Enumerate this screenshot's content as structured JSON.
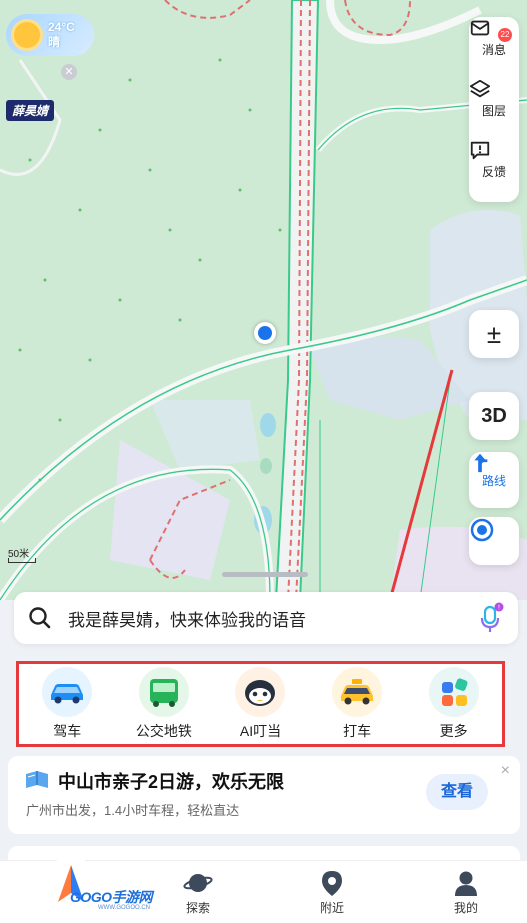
{
  "weather": {
    "temperature": "24°C",
    "condition": "晴",
    "icon": "sun-icon"
  },
  "user_tag": "薛昊婧",
  "side_panel": {
    "items": [
      {
        "label": "消息",
        "icon": "mail-icon",
        "badge": "22"
      },
      {
        "label": "图层",
        "icon": "layers-icon"
      },
      {
        "label": "反馈",
        "icon": "feedback-icon"
      }
    ]
  },
  "map_controls": {
    "zoom": "±",
    "three_d": "3D",
    "route": "路线",
    "locate_icon": "locate-icon"
  },
  "scale": "50米",
  "search": {
    "placeholder": "我是薛昊婧，快来体验我的语音",
    "mic_icon": "mic-icon"
  },
  "quick_actions": [
    {
      "label": "驾车",
      "icon": "car-icon",
      "bg": "#e6f4ff"
    },
    {
      "label": "公交地铁",
      "icon": "bus-icon",
      "bg": "#e4f7e8"
    },
    {
      "label": "AI叮当",
      "icon": "ai-assistant-icon",
      "bg": "#fff1e4"
    },
    {
      "label": "打车",
      "icon": "taxi-icon",
      "bg": "#fff4de"
    },
    {
      "label": "更多",
      "icon": "more-icon",
      "bg": "#e8f7f6"
    }
  ],
  "promo": {
    "title": "中山市亲子2日游，欢乐无限",
    "subtitle": "广州市出发，1.4小时车程，轻松直达",
    "button": "查看",
    "close": "×"
  },
  "tabs": [
    {
      "label": "探索",
      "icon": "planet-icon"
    },
    {
      "label": "附近",
      "icon": "pin-icon"
    },
    {
      "label": "我的",
      "icon": "user-icon"
    }
  ],
  "watermark": {
    "text": "GOGO手游网",
    "sub": "WWW.GOGOO.CN"
  },
  "colors": {
    "accent": "#1a73e8",
    "highlight_border": "#e5393b",
    "map_green": "#cfead4"
  }
}
